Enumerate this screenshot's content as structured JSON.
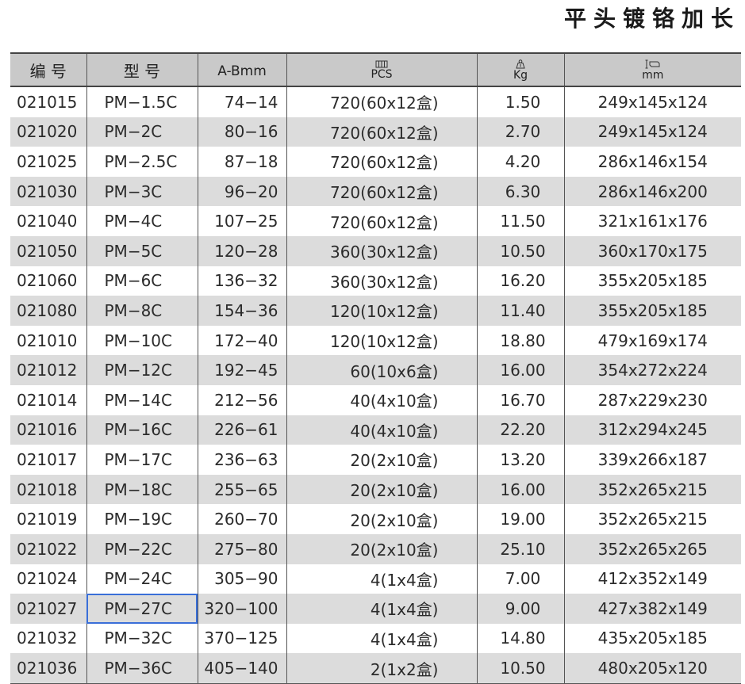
{
  "title": "平头镀铬加长",
  "headers": {
    "code": "编 号",
    "model": "型 号",
    "ab": "A-B",
    "ab_unit": "mm",
    "pcs_unit": "PCS",
    "kg_unit": "Kg",
    "dims_unit": "mm",
    "icons": [
      "box-stack-icon",
      "scale-weight-icon",
      "carton-dimension-icon"
    ]
  },
  "rows": [
    {
      "code": "021015",
      "model": "PM−1.5C",
      "ab": "74−14",
      "pcs": "720(60x12盒)",
      "kg": "1.50",
      "dims": "249x145x124"
    },
    {
      "code": "021020",
      "model": "PM−2C",
      "ab": "80−16",
      "pcs": "720(60x12盒)",
      "kg": "2.70",
      "dims": "249x145x124"
    },
    {
      "code": "021025",
      "model": "PM−2.5C",
      "ab": "87−18",
      "pcs": "720(60x12盒)",
      "kg": "4.20",
      "dims": "286x146x154"
    },
    {
      "code": "021030",
      "model": "PM−3C",
      "ab": "96−20",
      "pcs": "720(60x12盒)",
      "kg": "6.30",
      "dims": "286x146x200"
    },
    {
      "code": "021040",
      "model": "PM−4C",
      "ab": "107−25",
      "pcs": "720(60x12盒)",
      "kg": "11.50",
      "dims": "321x161x176"
    },
    {
      "code": "021050",
      "model": "PM−5C",
      "ab": "120−28",
      "pcs": "360(30x12盒)",
      "kg": "10.50",
      "dims": "360x170x175"
    },
    {
      "code": "021060",
      "model": "PM−6C",
      "ab": "136−32",
      "pcs": "360(30x12盒)",
      "kg": "16.20",
      "dims": "355x205x185"
    },
    {
      "code": "021080",
      "model": "PM−8C",
      "ab": "154−36",
      "pcs": "120(10x12盒)",
      "kg": "11.40",
      "dims": "355x205x185"
    },
    {
      "code": "021010",
      "model": "PM−10C",
      "ab": "172−40",
      "pcs": "120(10x12盒)",
      "kg": "18.80",
      "dims": "479x169x174"
    },
    {
      "code": "021012",
      "model": "PM−12C",
      "ab": "192−45",
      "pcs": "60(10x6盒)",
      "kg": "16.00",
      "dims": "354x272x224"
    },
    {
      "code": "021014",
      "model": "PM−14C",
      "ab": "212−56",
      "pcs": "40(4x10盒)",
      "kg": "16.70",
      "dims": "287x229x230"
    },
    {
      "code": "021016",
      "model": "PM−16C",
      "ab": "226−61",
      "pcs": "40(4x10盒)",
      "kg": "22.20",
      "dims": "312x294x245"
    },
    {
      "code": "021017",
      "model": "PM−17C",
      "ab": "236−63",
      "pcs": "20(2x10盒)",
      "kg": "13.20",
      "dims": "339x266x187"
    },
    {
      "code": "021018",
      "model": "PM−18C",
      "ab": "255−65",
      "pcs": "20(2x10盒)",
      "kg": "16.00",
      "dims": "352x265x215"
    },
    {
      "code": "021019",
      "model": "PM−19C",
      "ab": "260−70",
      "pcs": "20(2x10盒)",
      "kg": "19.00",
      "dims": "352x265x215"
    },
    {
      "code": "021022",
      "model": "PM−22C",
      "ab": "275−80",
      "pcs": "20(2x10盒)",
      "kg": "25.10",
      "dims": "352x265x265"
    },
    {
      "code": "021024",
      "model": "PM−24C",
      "ab": "305−90",
      "pcs": "4(1x4盒)",
      "kg": "7.00",
      "dims": "412x352x149"
    },
    {
      "code": "021027",
      "model": "PM−27C",
      "ab": "320−100",
      "pcs": "4(1x4盒)",
      "kg": "9.00",
      "dims": "427x382x149"
    },
    {
      "code": "021032",
      "model": "PM−32C",
      "ab": "370−125",
      "pcs": "4(1x4盒)",
      "kg": "14.80",
      "dims": "435x205x185"
    },
    {
      "code": "021036",
      "model": "PM−36C",
      "ab": "405−140",
      "pcs": "2(1x2盒)",
      "kg": "10.50",
      "dims": "480x205x120"
    }
  ],
  "selected_cell": {
    "row": 17,
    "column": "model"
  },
  "colors": {
    "header_bg": "#c9c9c9",
    "stripe_bg": "#dcdcdc",
    "selection": "#3a6fd8"
  }
}
